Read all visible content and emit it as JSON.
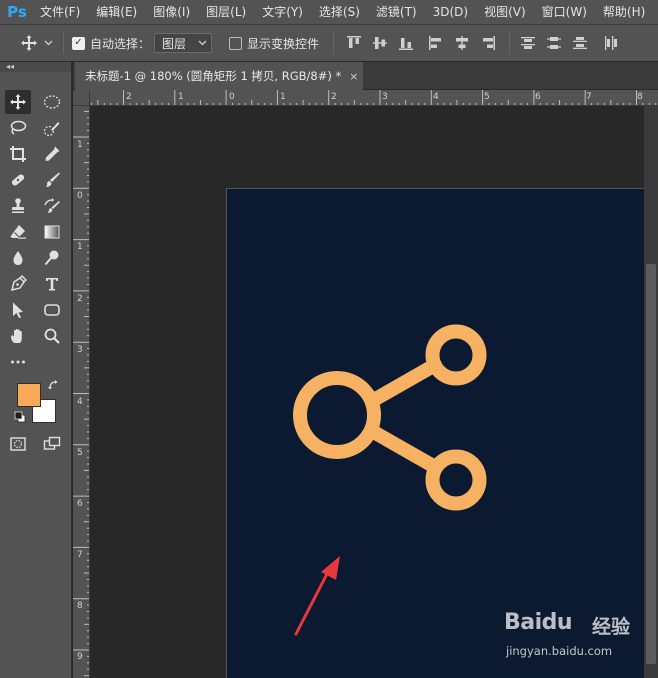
{
  "menubar": {
    "logo": "Ps",
    "items": [
      "文件(F)",
      "编辑(E)",
      "图像(I)",
      "图层(L)",
      "文字(Y)",
      "选择(S)",
      "滤镜(T)",
      "3D(D)",
      "视图(V)",
      "窗口(W)",
      "帮助(H)"
    ]
  },
  "options": {
    "auto_select_label": "自动选择：",
    "auto_select_checked": true,
    "layer_select_value": "图层",
    "show_transform_label": "显示变换控件",
    "show_transform_checked": false
  },
  "tab": {
    "title": "未标题-1 @ 180% (圆角矩形 1 拷贝, RGB/8#) *",
    "close": "×"
  },
  "ruler_h": [
    "2",
    "1",
    "0",
    "1",
    "2",
    "3",
    "4",
    "5",
    "6",
    "7",
    "8"
  ],
  "ruler_v": [
    "1",
    "0",
    "1",
    "2",
    "3",
    "4",
    "5",
    "6",
    "7",
    "8",
    "9"
  ],
  "colors": {
    "foreground": "#f9aa58",
    "background": "#ffffff",
    "canvas": "#0c1a31",
    "icon": "#f7b163",
    "arrow": "#e8383d"
  },
  "watermark": {
    "brand": "Baidu",
    "suffix": "经验",
    "url": "jingyan.baidu.com"
  }
}
